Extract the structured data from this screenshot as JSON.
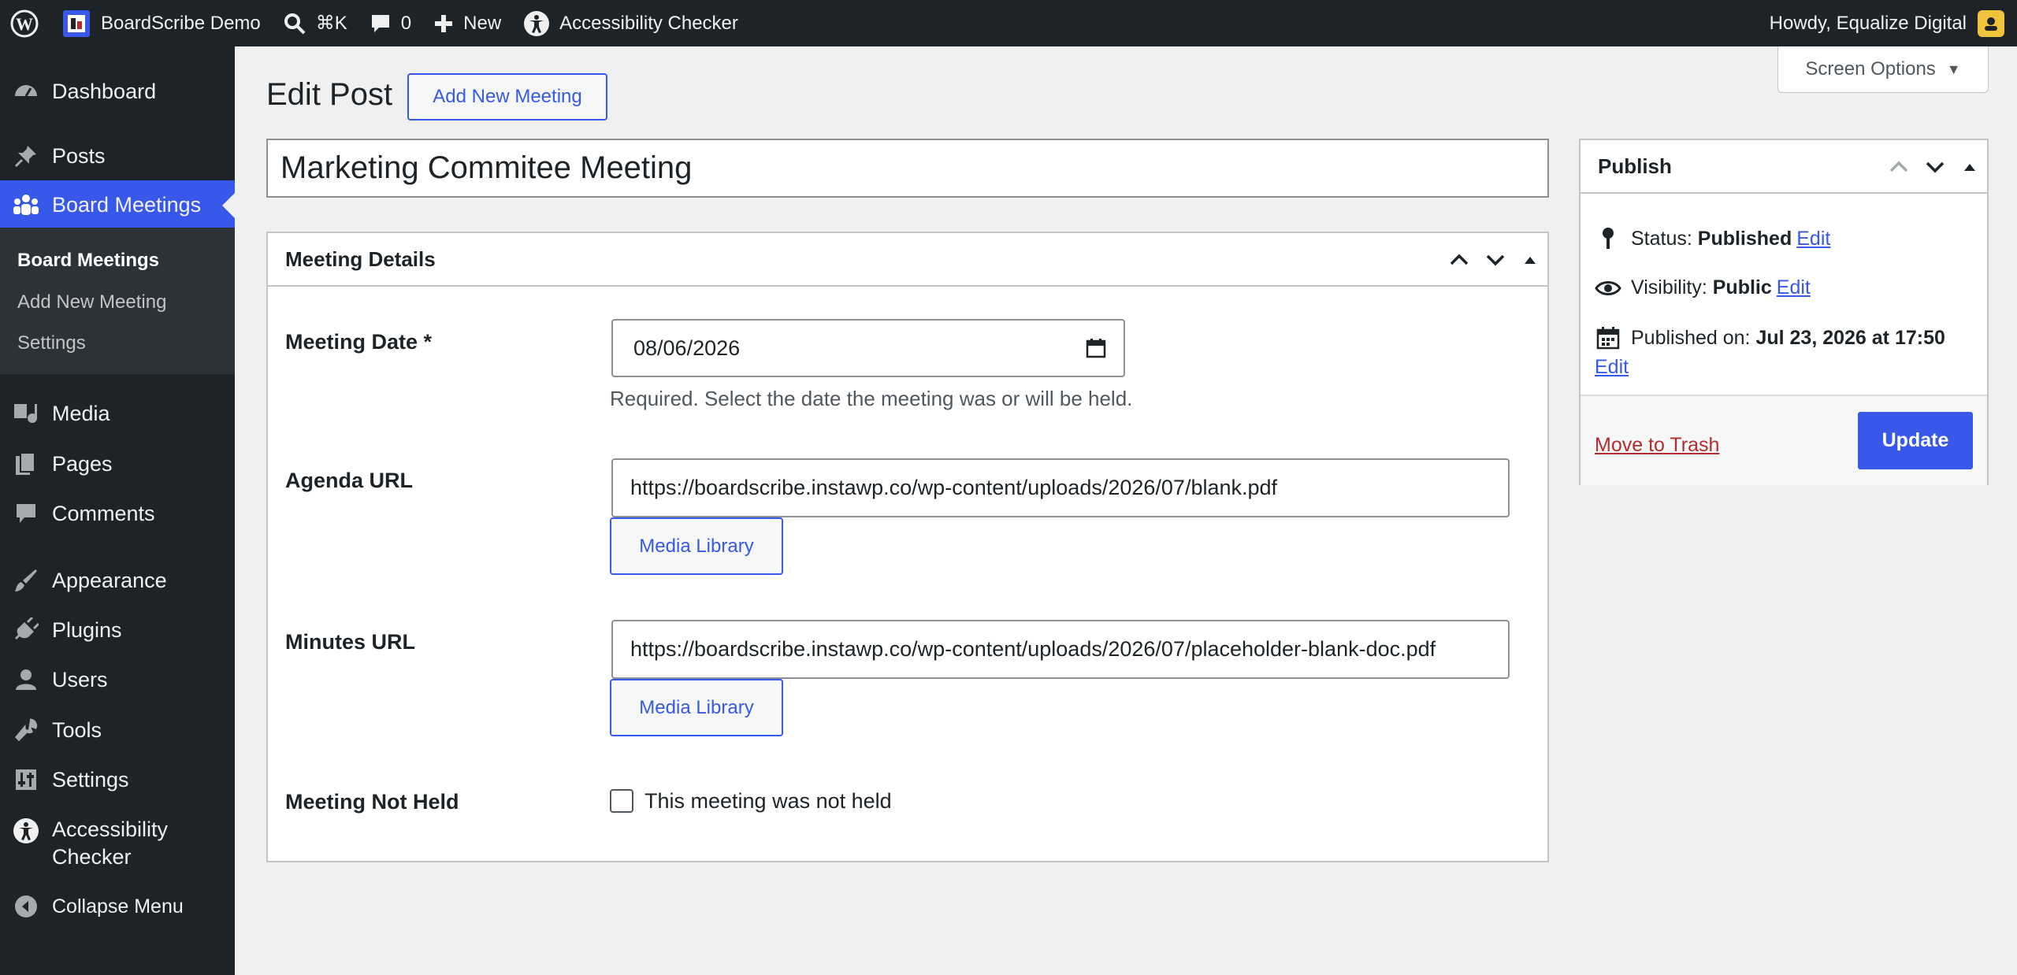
{
  "adminbar": {
    "site_name": "BoardScribe Demo",
    "search_shortcut": "⌘K",
    "comments_count": "0",
    "new_label": "New",
    "a11y_label": "Accessibility Checker",
    "howdy": "Howdy, Equalize Digital"
  },
  "sidebar": {
    "dashboard": "Dashboard",
    "posts": "Posts",
    "board_meetings": "Board Meetings",
    "sub": {
      "board_meetings": "Board Meetings",
      "add_new": "Add New Meeting",
      "settings": "Settings"
    },
    "media": "Media",
    "pages": "Pages",
    "comments": "Comments",
    "appearance": "Appearance",
    "plugins": "Plugins",
    "users": "Users",
    "tools": "Tools",
    "settings": "Settings",
    "accessibility_line1": "Accessibility",
    "accessibility_line2": "Checker",
    "collapse": "Collapse Menu"
  },
  "screen_options": "Screen Options",
  "page": {
    "title": "Edit Post",
    "add_new": "Add New Meeting",
    "post_title": "Marketing Commitee Meeting"
  },
  "meeting_details": {
    "heading": "Meeting Details",
    "date_label": "Meeting Date *",
    "date_value": "08/06/2026",
    "date_desc": "Required. Select the date the meeting was or will be held.",
    "agenda_label": "Agenda URL",
    "agenda_value": "https://boardscribe.instawp.co/wp-content/uploads/2026/07/blank.pdf",
    "media_library": "Media Library",
    "minutes_label": "Minutes URL",
    "minutes_value": "https://boardscribe.instawp.co/wp-content/uploads/2026/07/placeholder-blank-doc.pdf",
    "not_held_label": "Meeting Not Held",
    "not_held_checkbox": "This meeting was not held"
  },
  "publish": {
    "heading": "Publish",
    "status_label": "Status: ",
    "status_value": "Published",
    "visibility_label": "Visibility: ",
    "visibility_value": "Public",
    "published_label": "Published on: ",
    "published_value": "Jul 23, 2026 at 17:50",
    "edit": "Edit",
    "trash": "Move to Trash",
    "update": "Update"
  }
}
